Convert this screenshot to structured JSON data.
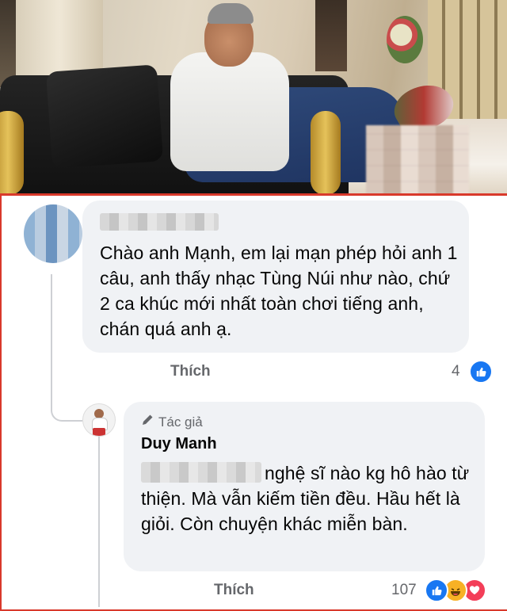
{
  "comment1": {
    "text": "Chào anh Mạnh, em lại mạn phép hỏi anh 1 câu, anh thấy nhạc Tùng Núi như nào, chứ 2 ca khúc mới nhất toàn chơi tiếng anh, chán quá anh ạ.",
    "like_label": "Thích",
    "reaction_count": "4",
    "reactions": [
      "like-icon"
    ]
  },
  "comment2": {
    "badge": "Tác giả",
    "author": "Duy Manh",
    "text": "nghệ sĩ nào kg hô hào từ thiện. Mà vẫn kiếm tiền đều. Hầu hết là giỏi. Còn chuyện khác miễn bàn.",
    "like_label": "Thích",
    "reaction_count": "107",
    "reactions": [
      "like-icon",
      "haha-icon",
      "love-icon"
    ]
  },
  "colors": {
    "frame": "#d9392b",
    "bubble": "#f0f2f5",
    "meta_text": "#65676b",
    "like_blue": "#1877f2"
  }
}
